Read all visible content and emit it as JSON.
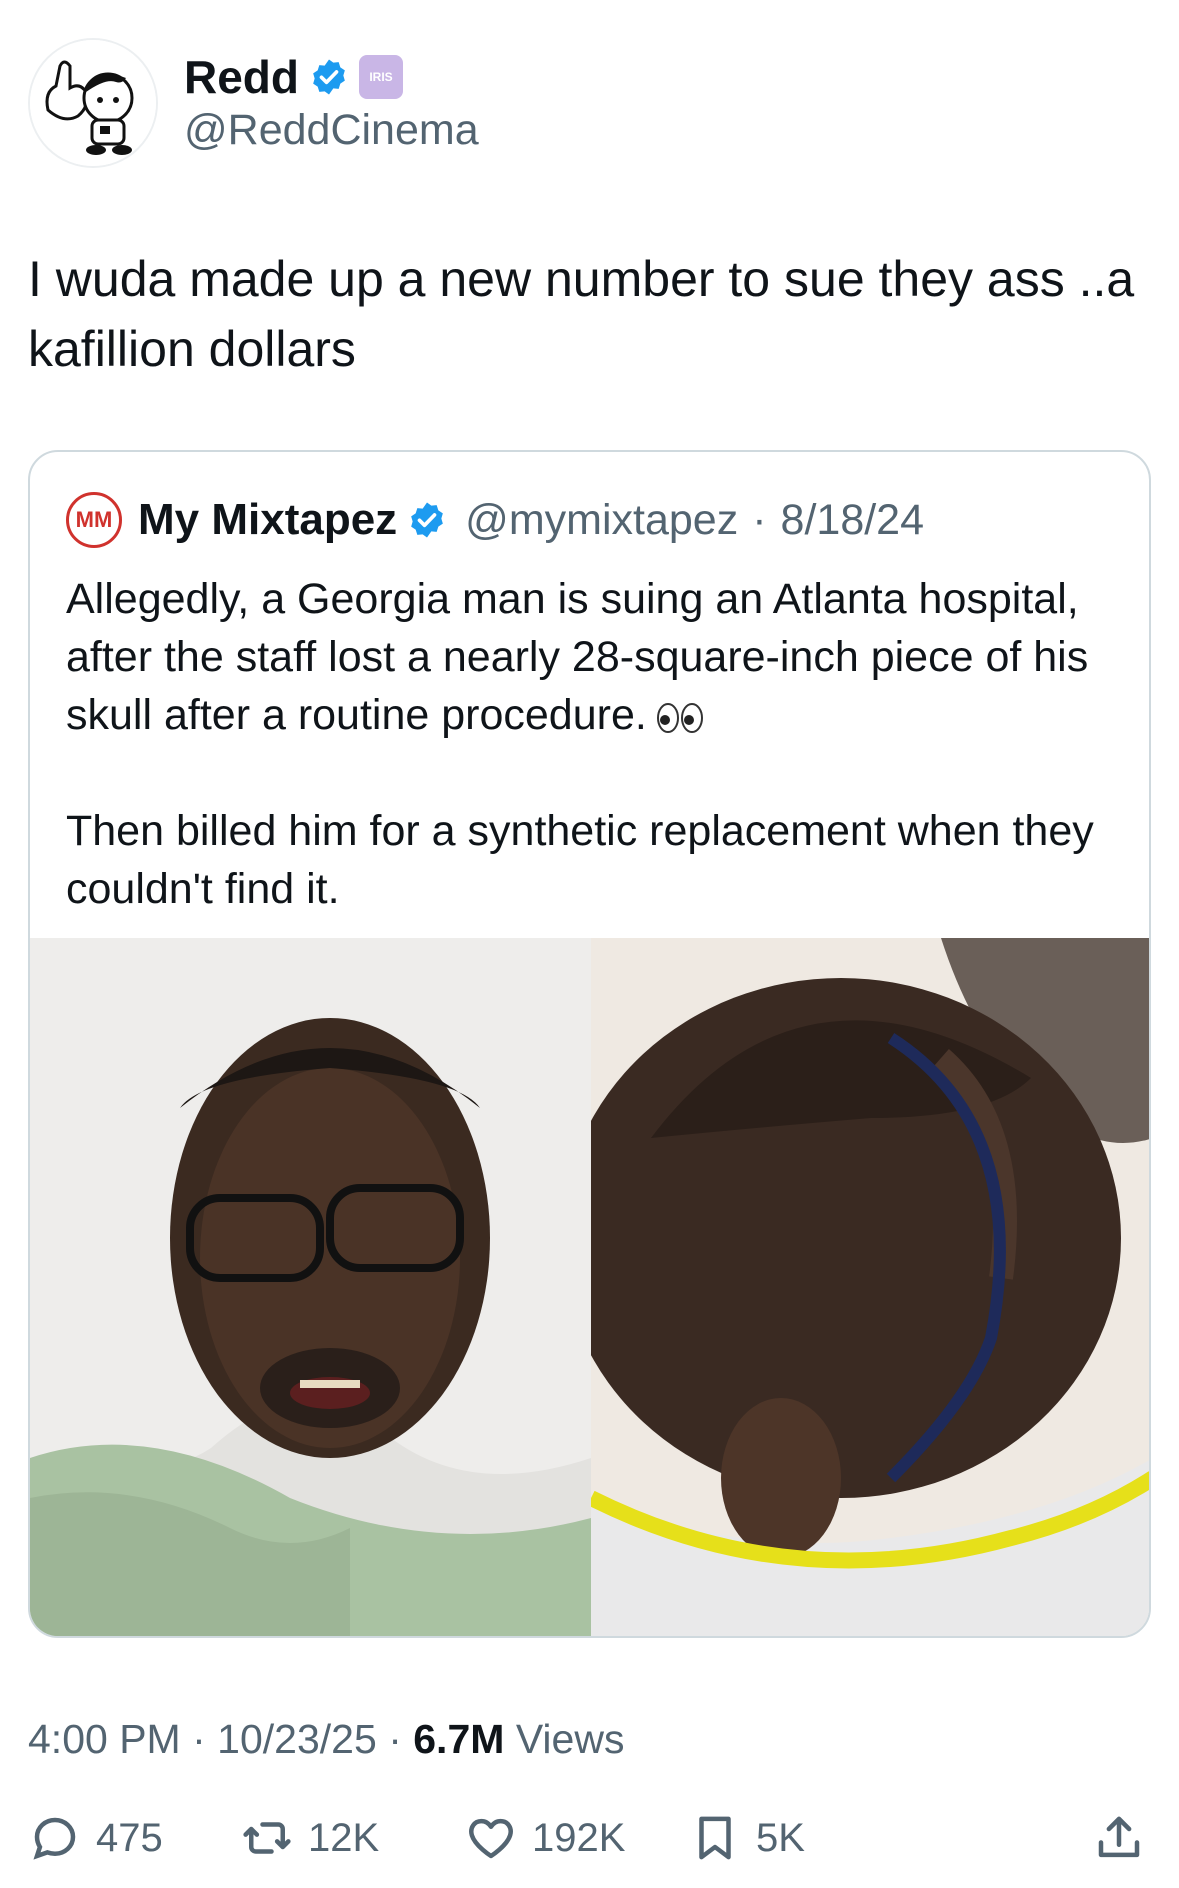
{
  "author": {
    "name": "Redd",
    "handle": "@ReddCinema",
    "iris_label": "IRIS"
  },
  "tweet": {
    "text": "I wuda made up a new number to sue they ass ..a kafillion dollars"
  },
  "quote": {
    "logo_text": "MM",
    "name": "My Mixtapez",
    "handle": "@mymixtapez",
    "separator": "·",
    "date": "8/18/24",
    "paragraph1": "Allegedly, a Georgia man is suing an Atlanta hospital, after the staff lost a nearly 28-square-inch piece of his skull after a routine procedure.",
    "paragraph2": "Then billed him for a synthetic replacement when they couldn't find it."
  },
  "meta": {
    "time": "4:00 PM",
    "sep1": "·",
    "date": "10/23/25",
    "sep2": "·",
    "views_count": "6.7M",
    "views_label": "Views"
  },
  "actions": {
    "replies": "475",
    "reposts": "12K",
    "likes": "192K",
    "bookmarks": "5K"
  },
  "colors": {
    "verified": "#1d9bf0",
    "secondary_text": "#536471",
    "border": "#cfd9de",
    "iris_badge": "#c9b6e6",
    "logo_red": "#d0322d"
  }
}
